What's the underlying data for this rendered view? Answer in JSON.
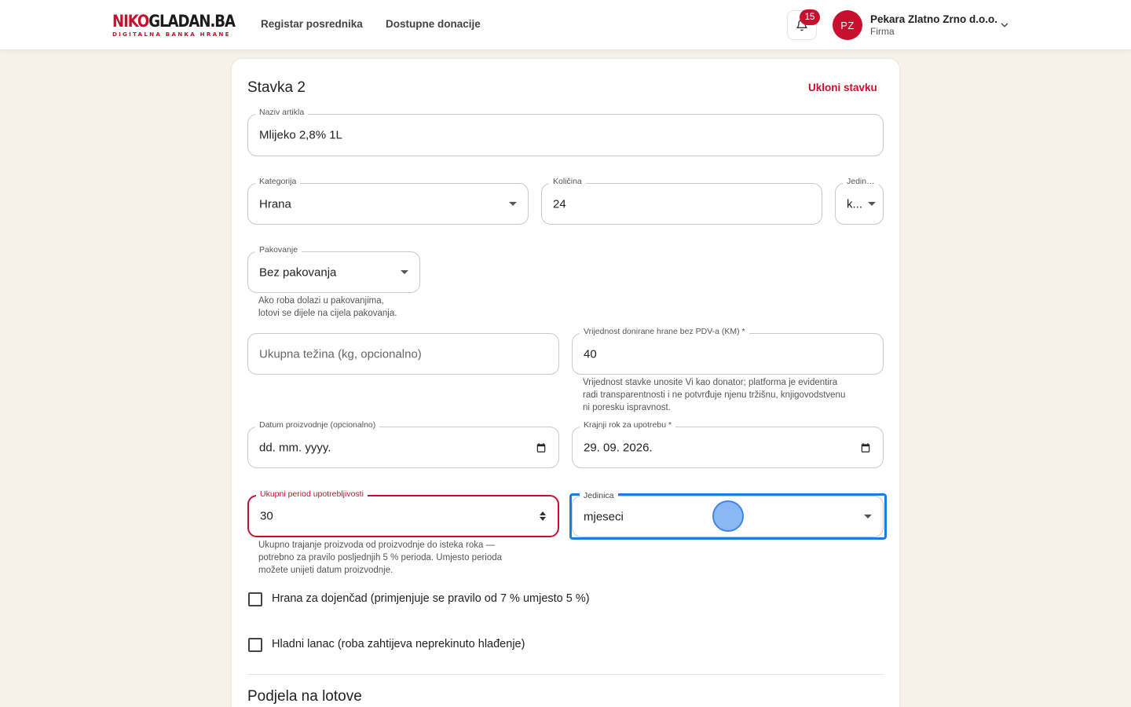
{
  "header": {
    "logo_part1": "NIKO",
    "logo_part2": "GLADAN.BA",
    "logo_tagline": "DIGITALNA BANKA HRANE",
    "nav": [
      "Registar posrednika",
      "Dostupne donacije"
    ],
    "notification_count": "15",
    "user_initials": "PZ",
    "user_name": "Pekara Zlatno Zrno d.o.o.",
    "user_role": "Firma"
  },
  "item": {
    "title": "Stavka 2",
    "remove_label": "Ukloni stavku",
    "article_name": {
      "label": "Naziv artikla",
      "value": "Mlijeko 2,8% 1L"
    },
    "category": {
      "label": "Kategorija",
      "value": "Hrana"
    },
    "quantity": {
      "label": "Količina",
      "value": "24"
    },
    "unit": {
      "label": "Jedini...",
      "value": "k..."
    },
    "packaging": {
      "label": "Pakovanje",
      "value": "Bez pakovanja",
      "helper": [
        "Ako roba dolazi u pakovanjima,",
        "lotovi se dijele na cijela pakovanja."
      ]
    },
    "total_weight": {
      "placeholder": "Ukupna težina (kg, opcionalno)"
    },
    "value_km": {
      "label": "Vrijednost donirane hrane bez PDV-a (KM) *",
      "value": "40",
      "helper": [
        "Vrijednost stavke unosite Vi kao donator; platforma je evidentira",
        "radi transparentnosti i ne potvrđuje njenu tržišnu, knjigovodstvenu",
        "ni poresku ispravnost."
      ]
    },
    "production_date": {
      "label": "Datum proizvodnje (opcionalno)",
      "value": "dd. mm. yyyy."
    },
    "expiry_date": {
      "label": "Krajnji rok za upotrebu *",
      "value": "29. 09. 2026."
    },
    "shelf_life": {
      "label": "Ukupni period upotrebljivosti",
      "value": "30",
      "helper": [
        "Ukupno trajanje proizvoda od proizvodnje do isteka roka —",
        "potrebno za pravilo posljednjih 5 % perioda. Umjesto perioda",
        "možete unijeti datum proizvodnje."
      ]
    },
    "shelf_life_unit": {
      "label": "Jedinica",
      "value": "mjeseci"
    },
    "infant_food_label": "Hrana za dojenčad (primjenjuje se pravilo od 7 % umjesto 5 %)",
    "cold_chain_label": "Hladni lanac (roba zahtijeva neprekinuto hlađenje)"
  },
  "lots_section_title": "Podjela na lotove",
  "colors": {
    "brand": "#c8102e",
    "focus": "#1a7ee0",
    "background": "#f8f1ea"
  }
}
